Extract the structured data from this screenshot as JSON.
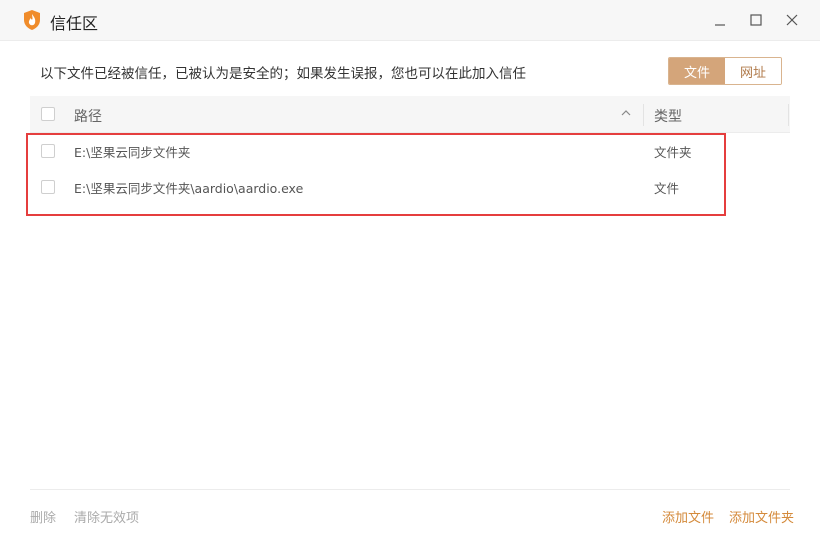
{
  "window": {
    "title": "信任区",
    "brand_color": "#f08c2b"
  },
  "description": "以下文件已经被信任，已被认为是安全的；如果发生误报，您也可以在此加入信任",
  "tabs": [
    {
      "label": "文件",
      "active": true
    },
    {
      "label": "网址",
      "active": false
    }
  ],
  "table": {
    "headers": {
      "path": "路径",
      "type": "类型"
    },
    "rows": [
      {
        "path": "E:\\坚果云同步文件夹",
        "type": "文件夹"
      },
      {
        "path": "E:\\坚果云同步文件夹\\aardio\\aardio.exe",
        "type": "文件"
      }
    ]
  },
  "footer": {
    "delete": "删除",
    "clear_invalid": "清除无效项",
    "add_file": "添加文件",
    "add_folder": "添加文件夹"
  },
  "colors": {
    "accent": "#d4a57a",
    "link": "#d48a3b",
    "highlight_border": "#e53e3e"
  }
}
